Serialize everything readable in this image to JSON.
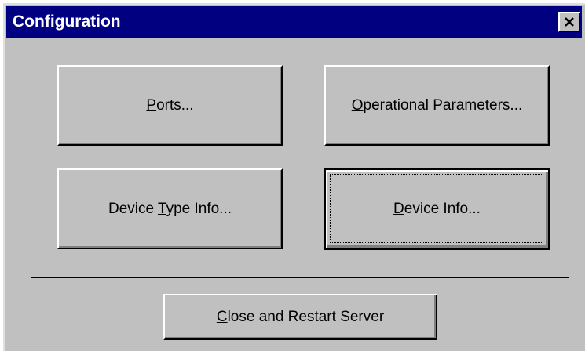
{
  "window": {
    "title": "Configuration",
    "close_label": "Close"
  },
  "buttons": {
    "ports": {
      "mnemonic": "P",
      "rest": "orts..."
    },
    "operational_parameters": {
      "mnemonic": "O",
      "rest": "perational Parameters..."
    },
    "device_type_info": {
      "before": "Device ",
      "mnemonic": "T",
      "rest": "ype Info..."
    },
    "device_info": {
      "mnemonic": "D",
      "rest": "evice Info..."
    },
    "close_restart": {
      "mnemonic": "C",
      "rest": "lose and Restart Server"
    }
  },
  "colors": {
    "titlebar": "#000080",
    "dialog_face": "#c0c0c0"
  }
}
